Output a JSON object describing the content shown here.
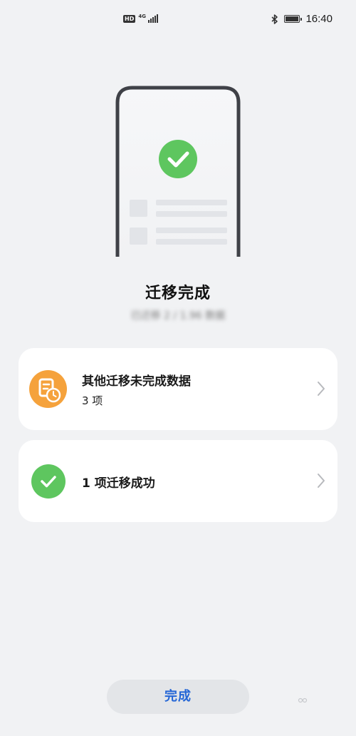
{
  "status_bar": {
    "hd": "HD",
    "network": "4G",
    "time": "16:40",
    "icons": [
      "hd-icon",
      "signal-icon",
      "bluetooth-icon",
      "battery-icon"
    ]
  },
  "illustration": {
    "icon": "check-circle-icon",
    "accent": "#5ec65f"
  },
  "header": {
    "title": "迁移完成",
    "subtitle": "已迁移 2 / 1.96 数据"
  },
  "cards": [
    {
      "title": "其他迁移未完成数据",
      "subtitle": "3 项",
      "icon": "document-clock-icon",
      "icon_color": "#f5a23c"
    },
    {
      "title": "1 项迁移成功",
      "icon": "check-icon",
      "icon_color": "#5ec65f"
    }
  ],
  "footer": {
    "done_label": "完成",
    "done_color": "#2466d6"
  }
}
